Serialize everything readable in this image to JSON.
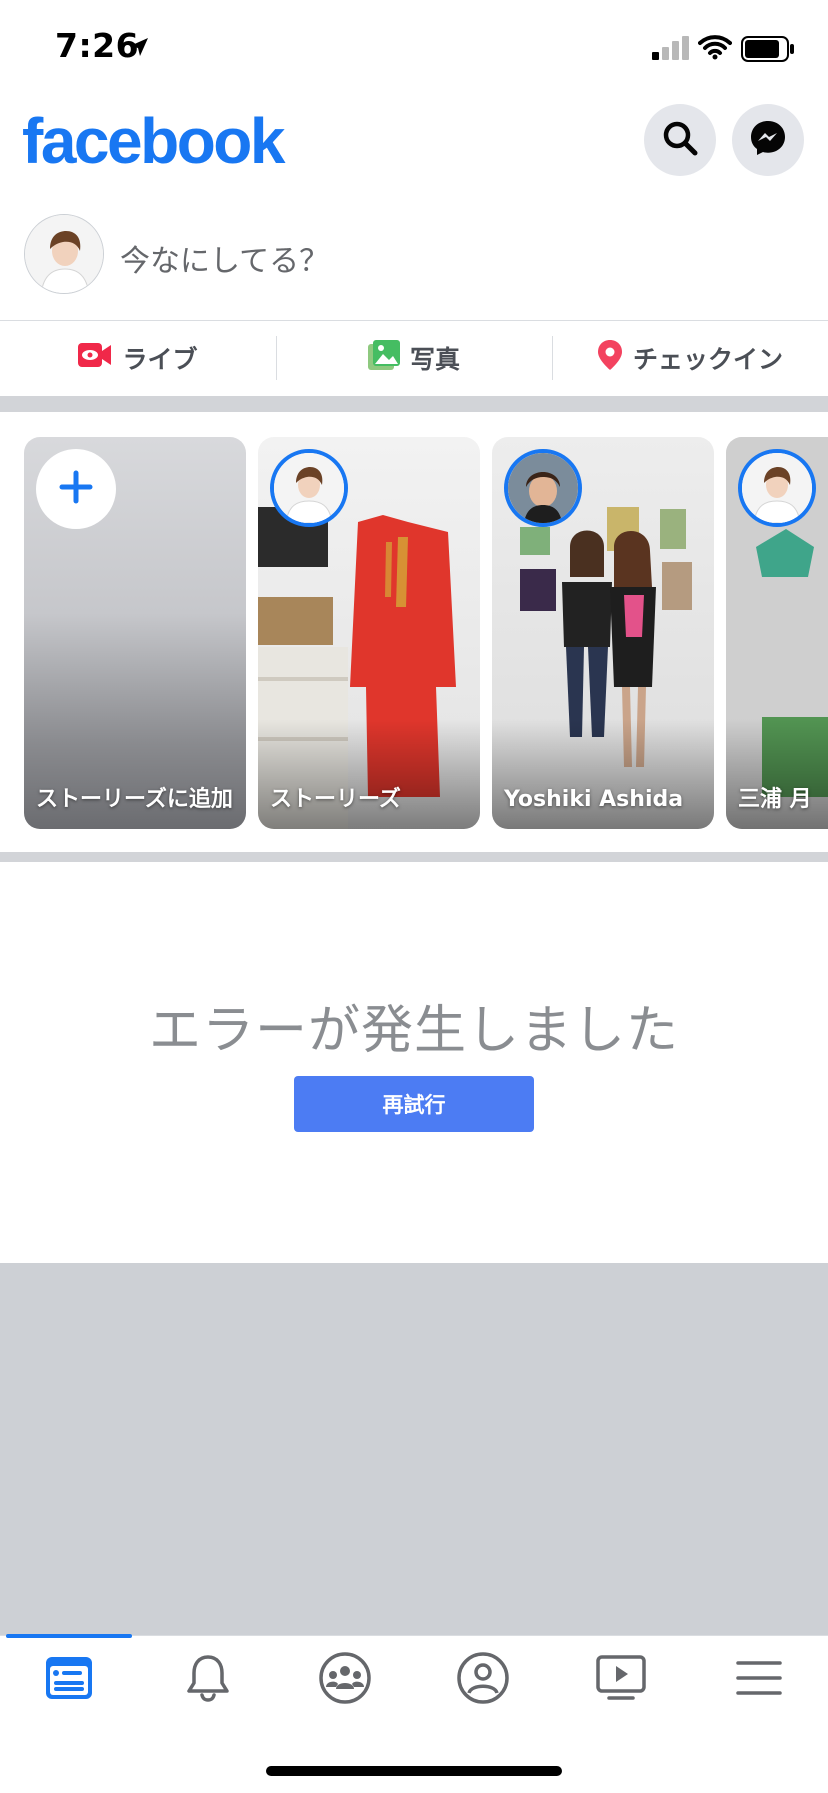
{
  "status_bar": {
    "time": "7:26",
    "icons": [
      "location-arrow-icon",
      "cellular-signal-icon",
      "wifi-icon",
      "battery-icon"
    ]
  },
  "header": {
    "logo_text": "facebook",
    "buttons": [
      "search-icon",
      "messenger-icon"
    ]
  },
  "composer": {
    "prompt": "今なにしてる？"
  },
  "actions": [
    {
      "label": "ライブ",
      "icon": "live-video-icon",
      "color": "#f02849"
    },
    {
      "label": "写真",
      "icon": "photo-icon",
      "color": "#45bd62"
    },
    {
      "label": "チェックイン",
      "icon": "location-pin-icon",
      "color": "#f3425f"
    }
  ],
  "stories": [
    {
      "label": "ストーリーズに追加",
      "icon": "plus-icon"
    },
    {
      "label": "ストーリーズ"
    },
    {
      "label": "Yoshiki Ashida"
    },
    {
      "label": "三浦 月"
    }
  ],
  "error": {
    "message": "エラーが発生しました",
    "retry_label": "再試行"
  },
  "tabbar": {
    "tabs": [
      "news-feed-icon",
      "notifications-bell-icon",
      "groups-icon",
      "profile-icon",
      "watch-video-icon",
      "menu-icon"
    ],
    "active_tab": "news-feed-icon"
  },
  "colors": {
    "brand_blue": "#1877f2",
    "retry_button": "#4c7cf3",
    "separator": "#d2d4d8",
    "empty_area": "#cdd0d5"
  }
}
